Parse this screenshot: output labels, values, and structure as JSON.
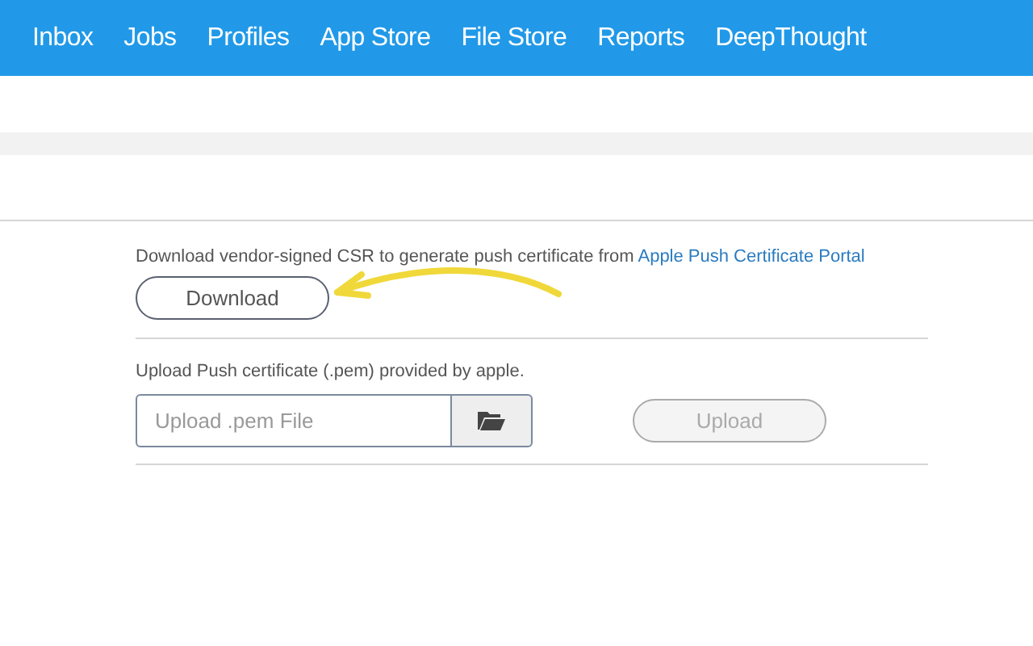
{
  "nav": {
    "items": [
      {
        "label": "Inbox"
      },
      {
        "label": "Jobs"
      },
      {
        "label": "Profiles"
      },
      {
        "label": "App Store"
      },
      {
        "label": "File Store"
      },
      {
        "label": "Reports"
      },
      {
        "label": "DeepThought"
      }
    ]
  },
  "download_section": {
    "text": "Download vendor-signed CSR to generate push certificate from ",
    "link": "Apple Push Certificate Portal",
    "button": {
      "label": "Download",
      "disabled": false
    }
  },
  "upload_section": {
    "text": "Upload Push certificate (.pem) provided by apple.",
    "file_field": {
      "placeholder": "Upload .pem File"
    },
    "button": {
      "label": "Upload",
      "disabled": true
    }
  }
}
